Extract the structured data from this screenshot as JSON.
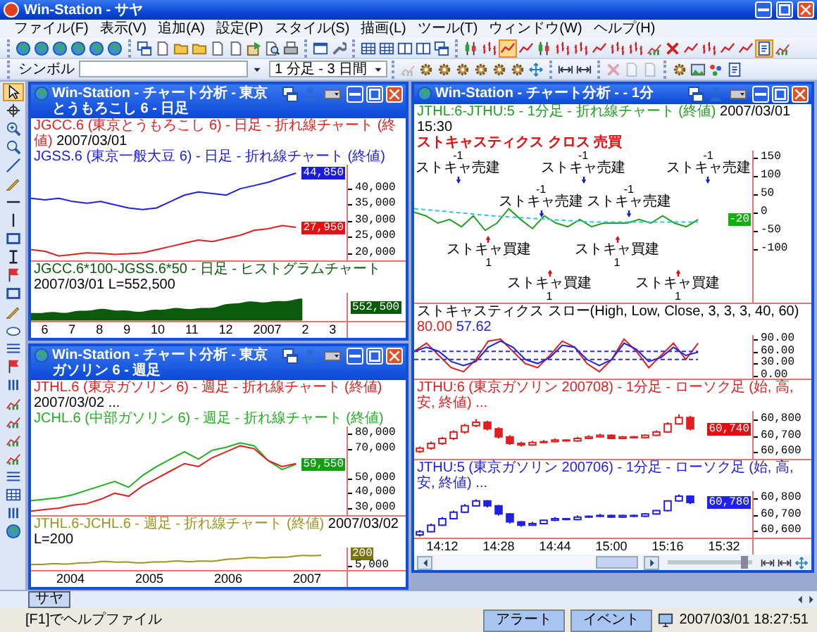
{
  "window": {
    "title": "Win-Station - サヤ"
  },
  "menu": [
    "ファイル(F)",
    "表示(V)",
    "追加(A)",
    "設定(P)",
    "スタイル(S)",
    "描画(L)",
    "ツール(T)",
    "ウィンドウ(W)",
    "ヘルプ(H)"
  ],
  "toolbar_1": [
    [
      {
        "kind": "globe",
        "selected": false
      },
      {
        "kind": "globe",
        "selected": false
      },
      {
        "kind": "globe",
        "selected": false
      },
      {
        "kind": "globe",
        "selected": false
      },
      {
        "kind": "globe",
        "selected": false
      },
      {
        "kind": "globe",
        "selected": false
      }
    ],
    [
      {
        "kind": "windows",
        "selected": false
      },
      {
        "kind": "document",
        "selected": false
      },
      {
        "kind": "folder",
        "selected": false
      },
      {
        "kind": "folder",
        "selected": false
      },
      {
        "kind": "document",
        "selected": false
      },
      {
        "kind": "document",
        "selected": false
      },
      {
        "kind": "boxarrow",
        "selected": false
      },
      {
        "kind": "preview",
        "selected": false
      },
      {
        "kind": "printer",
        "selected": false
      }
    ],
    [
      {
        "kind": "window",
        "selected": false
      },
      {
        "kind": "tools",
        "selected": false
      }
    ],
    [
      {
        "kind": "grid",
        "selected": false
      },
      {
        "kind": "grid",
        "selected": false
      },
      {
        "kind": "columns",
        "selected": false
      },
      {
        "kind": "columns",
        "selected": false
      },
      {
        "kind": "windows",
        "selected": false
      }
    ],
    [
      {
        "kind": "candle",
        "selected": false
      },
      {
        "kind": "bar",
        "selected": false
      },
      {
        "kind": "line",
        "selected": true
      },
      {
        "kind": "line",
        "selected": false
      },
      {
        "kind": "candle",
        "selected": false
      },
      {
        "kind": "bar",
        "selected": false
      },
      {
        "kind": "bar",
        "selected": false
      },
      {
        "kind": "line",
        "selected": false
      },
      {
        "kind": "bar",
        "selected": false
      },
      {
        "kind": "bar",
        "selected": false
      },
      {
        "kind": "chart",
        "selected": false
      },
      {
        "kind": "cross",
        "selected": false
      },
      {
        "kind": "line",
        "selected": false
      },
      {
        "kind": "bar",
        "selected": false
      },
      {
        "kind": "line",
        "selected": false
      },
      {
        "kind": "line",
        "selected": false
      },
      {
        "kind": "page",
        "selected": true
      },
      {
        "kind": "chart",
        "selected": false
      }
    ]
  ],
  "symbol_bar": {
    "label": "シンボル",
    "period": "1 分足 - 3 日間"
  },
  "toolbar_2": [
    [
      {
        "kind": "chart",
        "disabled": true
      },
      {
        "kind": "gear",
        "disabled": false
      },
      {
        "kind": "gear",
        "disabled": false
      },
      {
        "kind": "gear",
        "disabled": false
      },
      {
        "kind": "gear",
        "disabled": false
      },
      {
        "kind": "gear",
        "disabled": false
      },
      {
        "kind": "gear",
        "disabled": false
      },
      {
        "kind": "move",
        "disabled": false
      }
    ],
    [
      {
        "kind": "arrows",
        "disabled": false
      },
      {
        "kind": "arrows",
        "disabled": false
      }
    ],
    [
      {
        "kind": "cross",
        "disabled": true
      },
      {
        "kind": "document",
        "disabled": true
      },
      {
        "kind": "document",
        "disabled": true
      }
    ],
    [
      {
        "kind": "gear",
        "disabled": false
      },
      {
        "kind": "image",
        "disabled": false
      },
      {
        "kind": "dots",
        "disabled": false
      },
      {
        "kind": "page",
        "disabled": false
      }
    ]
  ],
  "drawing_tools": [
    {
      "kind": "cursor",
      "selected": true
    },
    {
      "kind": "crosshair",
      "selected": false
    },
    {
      "kind": "zoom",
      "selected": false
    },
    {
      "kind": "magnifier",
      "selected": false
    },
    {
      "kind": "diagonal",
      "selected": false
    },
    {
      "kind": "pencil",
      "selected": false
    },
    {
      "kind": "hline",
      "selected": false
    },
    {
      "kind": "vline",
      "selected": false
    },
    {
      "kind": "rectangle",
      "selected": false
    },
    {
      "kind": "text",
      "selected": false
    },
    {
      "kind": "flag",
      "selected": false
    },
    {
      "kind": "rectangle",
      "selected": false
    },
    {
      "kind": "pencil",
      "selected": false
    },
    {
      "kind": "cloud",
      "selected": false
    },
    {
      "kind": "lines",
      "selected": false
    },
    {
      "kind": "flag",
      "selected": false
    },
    {
      "kind": "bars",
      "selected": false
    },
    {
      "kind": "chart",
      "selected": false
    },
    {
      "kind": "chart",
      "selected": false
    },
    {
      "kind": "chart",
      "selected": false
    },
    {
      "kind": "chart",
      "selected": false
    },
    {
      "kind": "lines",
      "selected": false
    },
    {
      "kind": "grid",
      "selected": false
    },
    {
      "kind": "bars",
      "selected": false
    },
    {
      "kind": "globe",
      "selected": false
    }
  ],
  "chart_windows": [
    {
      "title": "Win-Station - チャート分析 - 東京とうもろこし 6 - 日足",
      "scrollbar": false,
      "panes": [
        {
          "kind": "line",
          "legends": [
            {
              "text": "JGCC.6 (東京とうもろこし 6) - 日足 - 折れ線チャート (終値)",
              "color": "#e02020",
              "date": "2007/03/01"
            },
            {
              "text": "JGSS.6 (東京一般大豆 6) - 日足 - 折れ線チャート (終値)",
              "color": "#2020e0"
            }
          ],
          "chart_data": {
            "type": "line",
            "categories": [
              null,
              null,
              null,
              null,
              null,
              null,
              null,
              null,
              null,
              null,
              null,
              null,
              null,
              null,
              null,
              null,
              null,
              null,
              null,
              null
            ],
            "ylim": [
              17500,
              47500
            ],
            "yticks": [
              {
                "value": 40000,
                "label": "40,000"
              },
              {
                "value": 35000,
                "label": "35,000"
              },
              {
                "value": 30000,
                "label": "30,000"
              },
              {
                "value": 25000,
                "label": "25,000"
              },
              {
                "value": 20000,
                "label": "20,000"
              }
            ],
            "series": [
              {
                "color": "#2020e0",
                "values": [
                  37000,
                  36500,
                  37000,
                  36000,
                  35500,
                  36000,
                  35000,
                  34000,
                  33500,
                  34000,
                  36000,
                  38000,
                  39000,
                  38500,
                  38000,
                  40000,
                  41000,
                  42000,
                  43500,
                  44850
                ]
              },
              {
                "color": "#e02020",
                "values": [
                  21000,
                  20500,
                  19000,
                  19500,
                  20000,
                  19800,
                  19500,
                  19700,
                  20000,
                  21000,
                  22000,
                  23000,
                  24000,
                  23500,
                  24500,
                  25500,
                  27000,
                  27500,
                  28500,
                  27950
                ]
              }
            ]
          },
          "tags": [
            {
              "text": "44,850",
              "color": "#1a1ae0"
            },
            {
              "text": "27,950",
              "color": "#e81010"
            }
          ]
        },
        {
          "kind": "histogram",
          "legends": [
            {
              "text": "JGCC.6*100-JGSS.6*50 - 日足 - ヒストグラムチャート",
              "color": "#0c5a0c",
              "date": "2007/03/01 L=552,500"
            }
          ],
          "axis": [
            {
              "kind": "tag",
              "text": "552,500",
              "color": "#0a5a0a"
            }
          ]
        }
      ],
      "x_axis": [
        "6",
        "7",
        "8",
        "9",
        "10",
        "11",
        "12",
        "2007",
        "2",
        "3"
      ]
    },
    {
      "title": "Win-Station - チャート分析 - 東京ガソリン 6 - 週足",
      "scrollbar": false,
      "panes": [
        {
          "kind": "line",
          "legends": [
            {
              "text": "JTHL.6 (東京ガソリン 6) - 週足 - 折れ線チャート (終値)",
              "color": "#e02020",
              "date": "2007/03/02 ..."
            },
            {
              "text": "JCHL.6 (中部ガソリン 6) - 週足 - 折れ線チャート (終値)",
              "color": "#20b020"
            }
          ],
          "chart_data": {
            "type": "line",
            "categories": [
              null,
              null,
              null,
              null,
              null,
              null,
              null,
              null,
              null,
              null,
              null,
              null,
              null,
              null,
              null,
              null,
              null,
              null,
              null,
              null
            ],
            "ylim": [
              25000,
              85000
            ],
            "yticks": [
              {
                "value": 80000,
                "label": "80,000"
              },
              {
                "value": 70000,
                "label": "70,000"
              },
              {
                "value": 50000,
                "label": "50,000"
              },
              {
                "value": 40000,
                "label": "40,000"
              },
              {
                "value": 30000,
                "label": "30,000"
              }
            ],
            "series": [
              {
                "color": "#20b020",
                "values": [
                  35000,
                  36000,
                  37000,
                  39000,
                  42000,
                  45000,
                  48000,
                  44000,
                  52000,
                  58000,
                  63000,
                  68000,
                  63000,
                  69000,
                  71000,
                  74000,
                  72000,
                  62000,
                  56000,
                  59550
                ]
              },
              {
                "color": "#e02020",
                "values": [
                  28000,
                  29000,
                  30000,
                  32000,
                  33000,
                  36000,
                  40000,
                  38000,
                  45000,
                  50000,
                  55000,
                  60000,
                  58000,
                  64000,
                  68000,
                  72000,
                  70000,
                  62000,
                  58000,
                  60000
                ]
              }
            ]
          },
          "tags": [
            {
              "text": "59,550",
              "color": "#10a010"
            }
          ]
        },
        {
          "kind": "line",
          "legends": [
            {
              "text": "JTHL.6-JCHL.6 - 週足 - 折れ線チャート (終値)",
              "color": "#9a9420",
              "date": "2007/03/02 L=200"
            }
          ],
          "axis": [
            {
              "kind": "tag",
              "text": "200",
              "color": "#7a7410"
            },
            {
              "kind": "tick",
              "text": "5,000"
            }
          ]
        }
      ],
      "x_axis": [
        "2004",
        "2005",
        "2006",
        "2007"
      ]
    },
    {
      "title": "Win-Station - チャート分析 - - 1分",
      "scrollbar": true,
      "zoom_slider": {
        "level": 0.95
      },
      "panes": [
        {
          "kind": "signals",
          "legends": [
            {
              "text": "JTHL:6-JTHU:5 - 1分足 - 折れ線チャート (終値)",
              "color": "#20a020",
              "date": "2007/03/01 15:30"
            }
          ],
          "subtitle": "ストキャスティクス クロス 売買",
          "chart_data": {
            "type": "line",
            "categories": [
              null,
              null,
              null,
              null,
              null,
              null,
              null,
              null,
              null,
              null,
              null,
              null,
              null,
              null,
              null,
              null,
              null,
              null,
              null,
              null,
              null,
              null,
              null,
              null,
              null
            ],
            "ylim": [
              -250,
              170
            ],
            "yticks": [
              {
                "value": 150,
                "label": "150"
              },
              {
                "value": 100,
                "label": "100"
              },
              {
                "value": 50,
                "label": "50"
              },
              {
                "value": 0,
                "label": "0"
              },
              {
                "value": -50,
                "label": "-50"
              },
              {
                "value": -100,
                "label": "-100"
              }
            ],
            "series": [
              {
                "color": "#20a020",
                "values": [
                  0,
                  -10,
                  -30,
                  -20,
                  -40,
                  -10,
                  -50,
                  -30,
                  10,
                  -20,
                  -45,
                  -10,
                  -30,
                  -40,
                  -20,
                  -40,
                  -30,
                  -30,
                  -30,
                  -20,
                  -30,
                  -10,
                  -30,
                  -40,
                  -20
                ]
              },
              {
                "color": "#30c8d8",
                "line_style": "dashed",
                "values": [
                  10,
                  7,
                  4,
                  1,
                  -2,
                  -5,
                  -8,
                  -11,
                  -13,
                  -15,
                  -17,
                  -19,
                  -21,
                  -23,
                  -25,
                  -27,
                  -27,
                  -27,
                  -27,
                  -27,
                  -27,
                  -27,
                  -27,
                  -27,
                  -27
                ]
              }
            ]
          },
          "tags": [
            {
              "text": "-20",
              "color": "#10b010"
            }
          ],
          "signals": [
            {
              "kind": "sell",
              "label": "ストキャ売建",
              "quantity": "-1"
            },
            {
              "kind": "sell",
              "label": "ストキャ売建",
              "quantity": "-1"
            },
            {
              "kind": "sell",
              "label": "ストキャ売建",
              "quantity": "-1"
            },
            {
              "kind": "sell",
              "label": "ストキャ売建",
              "quantity": "-1"
            },
            {
              "kind": "sell",
              "label": "ストキャ売建",
              "quantity": "-1"
            },
            {
              "kind": "buy",
              "label": "ストキャ買建",
              "quantity": "1"
            },
            {
              "kind": "buy",
              "label": "ストキャ買建",
              "quantity": "1"
            },
            {
              "kind": "buy",
              "label": "ストキャ買建",
              "quantity": "1"
            },
            {
              "kind": "buy",
              "label": "ストキャ買建",
              "quantity": "1"
            }
          ]
        },
        {
          "kind": "oscillator",
          "title": "ストキャスティクス スロー(High, Low, Close, 3, 3, 3, 40, 60)",
          "values": [
            {
              "text": "80.00",
              "color": "#e02020"
            },
            {
              "text": "57.62",
              "color": "#2020e0"
            }
          ],
          "chart_data": {
            "type": "line",
            "categories": [
              null,
              null,
              null,
              null,
              null,
              null,
              null,
              null,
              null,
              null,
              null,
              null,
              null,
              null,
              null,
              null,
              null,
              null,
              null,
              null,
              null,
              null,
              null,
              null
            ],
            "ylim": [
              -8,
              100
            ],
            "yticks": [
              {
                "value": 90,
                "label": "90.00"
              },
              {
                "value": 60,
                "label": "60.00"
              },
              {
                "value": 30,
                "label": "30.00"
              },
              {
                "value": 0,
                "label": "0.00"
              }
            ],
            "series": [
              {
                "color": "#e02020",
                "values": [
                  60,
                  80,
                  50,
                  20,
                  10,
                  40,
                  85,
                  90,
                  60,
                  30,
                  20,
                  50,
                  85,
                  70,
                  30,
                  10,
                  40,
                  90,
                  60,
                  20,
                  50,
                  80,
                  40,
                  80
                ]
              },
              {
                "color": "#2020e0",
                "values": [
                  60,
                  70,
                  60,
                  35,
                  25,
                  35,
                  70,
                  85,
                  70,
                  40,
                  30,
                  45,
                  75,
                  70,
                  40,
                  25,
                  40,
                  80,
                  65,
                  35,
                  45,
                  70,
                  50,
                  58
                ]
              },
              {
                "color": "#3030e0",
                "line_style": "dashed",
                "values": [
                  60,
                  60,
                  60,
                  60,
                  60,
                  60,
                  60,
                  60,
                  60,
                  60,
                  60,
                  60,
                  60,
                  60,
                  60,
                  60,
                  60,
                  60,
                  60,
                  60,
                  60,
                  60,
                  60,
                  60
                ]
              },
              {
                "color": "#3030e0",
                "line_style": "dashed",
                "values": [
                  40,
                  40,
                  40,
                  40,
                  40,
                  40,
                  40,
                  40,
                  40,
                  40,
                  40,
                  40,
                  40,
                  40,
                  40,
                  40,
                  40,
                  40,
                  40,
                  40,
                  40,
                  40,
                  40,
                  40
                ]
              }
            ]
          }
        },
        {
          "kind": "candles",
          "legends": [
            {
              "text": "JTHU:6 (東京ガソリン 200708) - 1分足 - ローソク足 (始, 高, 安, 終値) ...",
              "color": "#e02020"
            }
          ],
          "chart_data": {
            "type": "candlestick",
            "categories": [
              null,
              null,
              null,
              null,
              null,
              null,
              null,
              null,
              null,
              null,
              null,
              null,
              null,
              null,
              null,
              null,
              null,
              null,
              null,
              null,
              null,
              null,
              null,
              null,
              null,
              null,
              null,
              null,
              null,
              null
            ],
            "ylim": [
              60560,
              60850
            ],
            "yticks": [
              {
                "value": 60800,
                "label": "60,800"
              },
              {
                "value": 60700,
                "label": "60,700"
              },
              {
                "value": 60600,
                "label": "60,600"
              }
            ],
            "series": [
              {
                "color": "#e02020",
                "ohlc": [
                  [
                    60600,
                    60630,
                    60590,
                    60620
                  ],
                  [
                    60620,
                    60660,
                    60610,
                    60650
                  ],
                  [
                    60650,
                    60690,
                    60640,
                    60680
                  ],
                  [
                    60680,
                    60730,
                    60670,
                    60720
                  ],
                  [
                    60720,
                    60770,
                    60710,
                    60760
                  ],
                  [
                    60760,
                    60800,
                    60750,
                    60780
                  ],
                  [
                    60780,
                    60790,
                    60730,
                    60740
                  ],
                  [
                    60740,
                    60750,
                    60680,
                    60690
                  ],
                  [
                    60690,
                    60700,
                    60640,
                    60650
                  ],
                  [
                    60650,
                    60660,
                    60630,
                    60640
                  ],
                  [
                    60640,
                    60665,
                    60635,
                    60655
                  ],
                  [
                    60655,
                    60670,
                    60650,
                    60660
                  ],
                  [
                    60660,
                    60680,
                    60655,
                    60670
                  ],
                  [
                    60670,
                    60675,
                    60660,
                    60665
                  ],
                  [
                    60665,
                    60690,
                    60660,
                    60680
                  ],
                  [
                    60680,
                    60700,
                    60675,
                    60690
                  ],
                  [
                    60690,
                    60710,
                    60685,
                    60700
                  ],
                  [
                    60700,
                    60705,
                    60675,
                    60680
                  ],
                  [
                    60680,
                    60695,
                    60675,
                    60690
                  ],
                  [
                    60690,
                    60695,
                    60680,
                    60685
                  ],
                  [
                    60685,
                    60705,
                    60680,
                    60700
                  ],
                  [
                    60700,
                    60730,
                    60695,
                    60720
                  ],
                  [
                    60720,
                    60780,
                    60715,
                    60770
                  ],
                  [
                    60770,
                    60830,
                    60765,
                    60810
                  ],
                  [
                    60810,
                    60820,
                    60730,
                    60740
                  ],
                  null,
                  null,
                  null,
                  null,
                  null
                ]
              }
            ]
          },
          "tags": [
            {
              "text": "60,740",
              "color": "#e01010"
            }
          ]
        },
        {
          "kind": "candles",
          "legends": [
            {
              "text": "JTHU:5 (東京ガソリン 200706) - 1分足 - ローソク足 (始, 高, 安, 終値) ...",
              "color": "#2020e0"
            }
          ],
          "chart_data": {
            "type": "candlestick",
            "categories": [
              null,
              null,
              null,
              null,
              null,
              null,
              null,
              null,
              null,
              null,
              null,
              null,
              null,
              null,
              null,
              null,
              null,
              null,
              null,
              null,
              null,
              null,
              null,
              null,
              null,
              null,
              null,
              null,
              null,
              null
            ],
            "ylim": [
              60560,
              60850
            ],
            "yticks": [
              {
                "value": 60800,
                "label": "60,800"
              },
              {
                "value": 60700,
                "label": "60,700"
              },
              {
                "value": 60600,
                "label": "60,600"
              }
            ],
            "series": [
              {
                "color": "#2020e0",
                "ohlc": [
                  [
                    60580,
                    60610,
                    60570,
                    60600
                  ],
                  [
                    60600,
                    60650,
                    60595,
                    60640
                  ],
                  [
                    60640,
                    60690,
                    60635,
                    60680
                  ],
                  [
                    60680,
                    60730,
                    60675,
                    60720
                  ],
                  [
                    60720,
                    60770,
                    60715,
                    60760
                  ],
                  [
                    60760,
                    60800,
                    60755,
                    60790
                  ],
                  [
                    60790,
                    60795,
                    60750,
                    60760
                  ],
                  [
                    60760,
                    60765,
                    60700,
                    60710
                  ],
                  [
                    60710,
                    60715,
                    60650,
                    60660
                  ],
                  [
                    60660,
                    60665,
                    60630,
                    60640
                  ],
                  [
                    60640,
                    60660,
                    60635,
                    60650
                  ],
                  [
                    60650,
                    60675,
                    60645,
                    60670
                  ],
                  [
                    60670,
                    60690,
                    60665,
                    60680
                  ],
                  [
                    60680,
                    60685,
                    60670,
                    60675
                  ],
                  [
                    60675,
                    60700,
                    60670,
                    60690
                  ],
                  [
                    60690,
                    60700,
                    60685,
                    60695
                  ],
                  [
                    60695,
                    60710,
                    60690,
                    60700
                  ],
                  [
                    60700,
                    60705,
                    60685,
                    60690
                  ],
                  [
                    60690,
                    60705,
                    60685,
                    60700
                  ],
                  [
                    60700,
                    60705,
                    60690,
                    60695
                  ],
                  [
                    60695,
                    60715,
                    60690,
                    60710
                  ],
                  [
                    60710,
                    60735,
                    60705,
                    60730
                  ],
                  [
                    60730,
                    60795,
                    60725,
                    60790
                  ],
                  [
                    60790,
                    60830,
                    60785,
                    60820
                  ],
                  [
                    60820,
                    60825,
                    60770,
                    60780
                  ],
                  null,
                  null,
                  null,
                  null,
                  null
                ]
              }
            ]
          },
          "tags": [
            {
              "text": "60,780",
              "color": "#2020f0"
            }
          ]
        }
      ],
      "x_axis": [
        "14:12",
        "14:28",
        "14:44",
        "15:00",
        "15:16",
        "15:32"
      ]
    }
  ],
  "tabs": [
    {
      "label": "サヤ",
      "selected": true
    }
  ],
  "status_bar": {
    "help": "[F1]でヘルプファイル",
    "buttons": [
      "アラート",
      "イベント"
    ],
    "datetime": "2007/03/01 18:27:51"
  }
}
